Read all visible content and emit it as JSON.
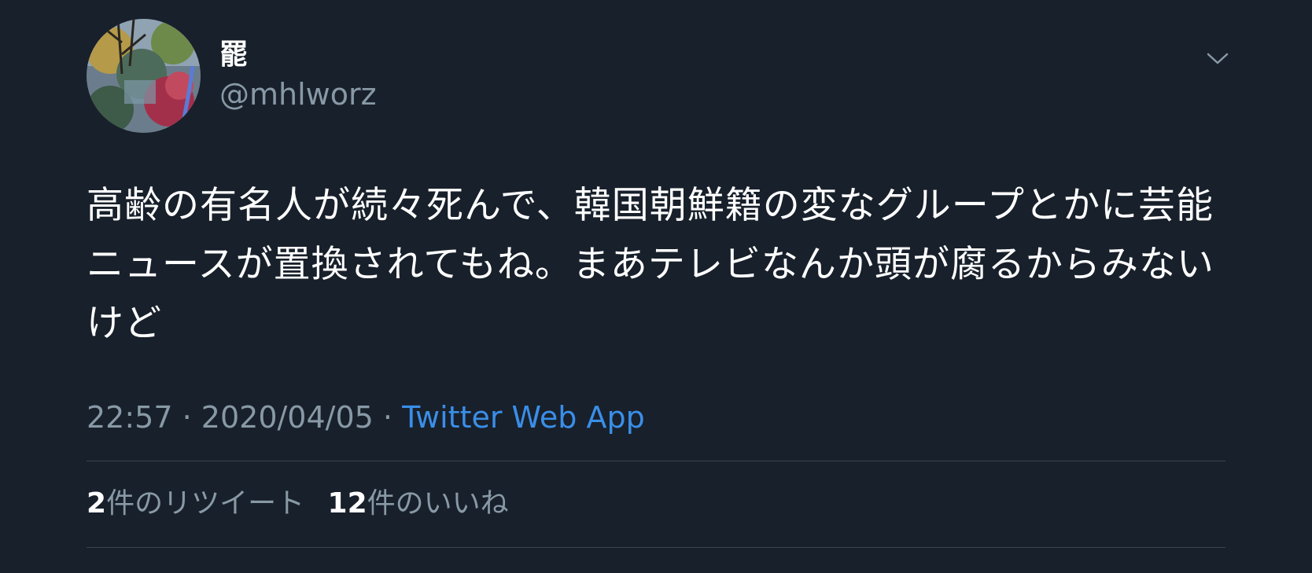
{
  "user": {
    "display_name": "罷",
    "handle": "@mhlworz",
    "avatar_icon": "avatar-autumn-trees"
  },
  "menu": {
    "icon": "chevron-down-icon"
  },
  "tweet": {
    "text": "高齢の有名人が続々死んで、韓国朝鮮籍の変なグループとかに芸能ニュースが置換されてもね。まあテレビなんか頭が腐るからみないけど"
  },
  "meta": {
    "time": "22:57",
    "separator1": "·",
    "date": "2020/04/05",
    "separator2": "·",
    "source": "Twitter Web App"
  },
  "stats": {
    "retweets_count": "2",
    "retweets_label": "件のリツイート",
    "likes_count": "12",
    "likes_label": "件のいいね"
  },
  "colors": {
    "background": "#18202b",
    "text_primary": "#ffffff",
    "text_secondary": "#8899a6",
    "link": "#3a8ee8",
    "divider": "#38444d"
  }
}
